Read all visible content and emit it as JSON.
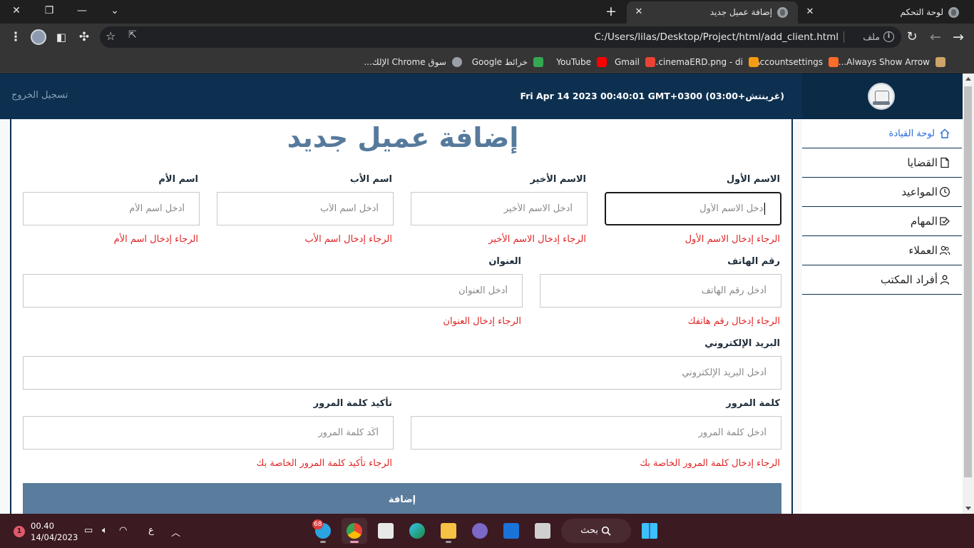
{
  "browser": {
    "tabs": [
      {
        "title": "لوحة التحكم",
        "active": false
      },
      {
        "title": "إضافة عميل جديد",
        "active": true
      }
    ],
    "address": {
      "file_label": "ملف",
      "url": "C:/Users/lilas/Desktop/Project/html/add_client.html"
    },
    "bookmarks": [
      {
        "label": "Always Show Arrow...",
        "icon_color": "#cfa36a"
      },
      {
        "label": "Accountsettings",
        "icon_color": "#ff6c2c"
      },
      {
        "label": "cinemaERD.png - di...",
        "icon_color": "#f39c12"
      },
      {
        "label": "Gmail",
        "icon_color": "#ea4335"
      },
      {
        "label": "YouTube",
        "icon_color": "#ff0000"
      },
      {
        "label": "خرائط Google",
        "icon_color": "#34a853"
      },
      {
        "label": "سوق Chrome الإلك...",
        "icon_color": "#4285f4"
      }
    ]
  },
  "navbar": {
    "logout_label": "تسجيل الخروج",
    "datetime": "Fri Apr 14 2023 00:40:01 GMT+0300 (غرينتش+03:00)"
  },
  "sidebar": {
    "items": [
      {
        "label": "لوحة القيادة",
        "icon": "home-icon",
        "active": true
      },
      {
        "label": "القضايا",
        "icon": "file-icon",
        "active": false
      },
      {
        "label": "المواعيد",
        "icon": "clock-icon",
        "active": false
      },
      {
        "label": "المهام",
        "icon": "tasks-icon",
        "active": false
      },
      {
        "label": "العملاء",
        "icon": "users-icon",
        "active": false
      },
      {
        "label": "أفراد المكتب",
        "icon": "person-icon",
        "active": false
      }
    ]
  },
  "form": {
    "title": "إضافة عميل جديد",
    "first_name": {
      "label": "الاسم الأول",
      "placeholder": "أدخل الاسم الأول",
      "error": "الرجاء إدخال الاسم الأول"
    },
    "last_name": {
      "label": "الاسم الأخير",
      "placeholder": "أدخل الاسم الأخير",
      "error": "الرجاء إدخال الاسم الأخير"
    },
    "father_name": {
      "label": "اسم الأب",
      "placeholder": "أدخل اسم الأب",
      "error": "الرجاء إدخال اسم الأب"
    },
    "mother_name": {
      "label": "اسم الأم",
      "placeholder": "أدخل اسم الأم",
      "error": "الرجاء إدخال اسم الأم"
    },
    "phone": {
      "label": "رقم الهاتف",
      "placeholder": "أدخل رقم الهاتف",
      "error": "الرجاء إدخال رقم هاتفك"
    },
    "address": {
      "label": "العنوان",
      "placeholder": "أدخل العنوان",
      "error": "الرجاء إدخال العنوان"
    },
    "email": {
      "label": "البريد الإلكتروني",
      "placeholder": "أدخل البريد الإلكتروني"
    },
    "password": {
      "label": "كلمة المرور",
      "placeholder": "أدخل كلمة المرور",
      "error": "الرجاء إدخال كلمة المرور الخاصة بك"
    },
    "confirm_password": {
      "label": "تأكيد كلمة المرور",
      "placeholder": "أكّد كلمة المرور",
      "error": "الرجاء تأكيد كلمة المرور الخاصة بك"
    },
    "submit_label": "إضافة"
  },
  "taskbar": {
    "search_label": "بحث",
    "telegram_badge": "68",
    "time": "00.40",
    "date": "14/04/2023",
    "input_language": "ع",
    "notification_count": "1"
  }
}
